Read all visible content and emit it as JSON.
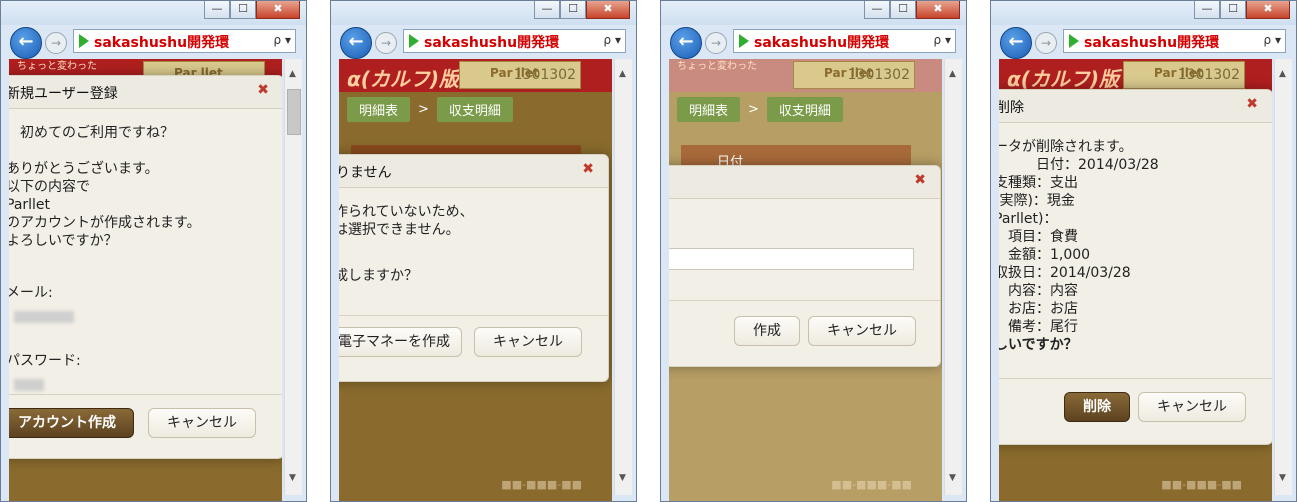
{
  "browser": {
    "url": "sakashushu開発環",
    "search_glyph": "ρ",
    "dropdown_glyph": "▾",
    "back_glyph": "←",
    "forward_glyph": "→",
    "min_glyph": "—",
    "max_glyph": "☐",
    "close_glyph": "✖"
  },
  "site": {
    "tagline": "ちょっと変わった",
    "logo": "α(カルフ)版",
    "banner_brand": "Par llet",
    "banner_number": "1301302",
    "crumb_1": "明細表",
    "crumb_sep": ">",
    "crumb_2": "収支明細",
    "table_head": "日付"
  },
  "panel1": {
    "title": "新規ユーザー登録",
    "close": "✖",
    "lines": [
      "初めてのご利用ですね？",
      "",
      "ありがとうございます。",
      "以下の内容で",
      "Parllet",
      "のアカウントが作成されます。",
      "よろしいですか？"
    ],
    "label_email": "メール:",
    "label_password": "パスワード:",
    "primary_button": "アカウント作成",
    "cancel_button": "キャンセル"
  },
  "panel2": {
    "title": "りません",
    "close": "✖",
    "lines": [
      "作られていないため、",
      "は選択できません。",
      "",
      "",
      "成しますか？"
    ],
    "primary_button": "電子マネーを作成",
    "cancel_button": "キャンセル"
  },
  "panel3": {
    "close": "✖",
    "input_value": "",
    "primary_button": "作成",
    "cancel_button": "キャンセル"
  },
  "panel4": {
    "title": "削除",
    "close": "✖",
    "lines": [
      "ータが削除されます。",
      "　　　日付：2014/03/28",
      "支種類：支出",
      "(実際)：現金",
      "Parllet)：",
      "　項目：食費",
      "　金額：1,000",
      "取扱日：2014/03/28",
      "　内容：内容",
      "　お店：お店",
      "　備考：尾行",
      "しいですか？"
    ],
    "primary_button": "削除",
    "cancel_button": "キャンセル"
  }
}
